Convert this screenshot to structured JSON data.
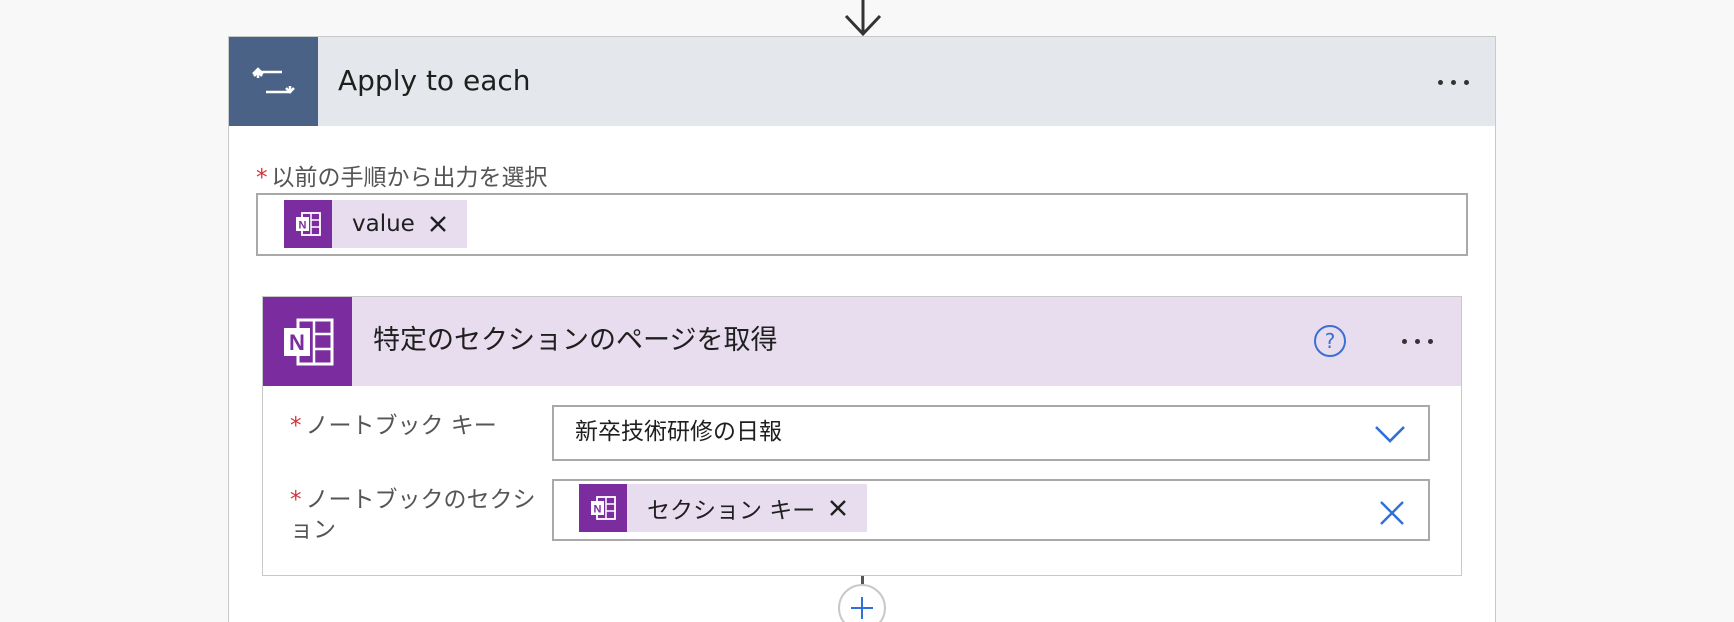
{
  "apply_to_each": {
    "title": "Apply to each",
    "icon": "loop-icon",
    "header_color": "#4a6285",
    "more_label": "...",
    "output_field": {
      "required_mark": "*",
      "label": "以前の手順から出力を選択",
      "token": {
        "icon": "onenote-icon",
        "text": "value"
      }
    }
  },
  "get_pages_action": {
    "title": "特定のセクションのページを取得",
    "icon": "onenote-icon",
    "header_color": "#7b2c9e",
    "help_label": "?",
    "fields": {
      "notebook_key": {
        "required_mark": "*",
        "label": "ノートブック キー",
        "value": "新卒技術研修の日報"
      },
      "notebook_section": {
        "required_mark": "*",
        "label_line1": "ノートブックのセクシ",
        "label_line2": "ョン",
        "token": {
          "icon": "onenote-icon",
          "text": "セクション キー"
        }
      }
    }
  },
  "flow": {
    "add_step_icon": "plus-icon",
    "arrow_icon": "arrow-down-icon"
  }
}
